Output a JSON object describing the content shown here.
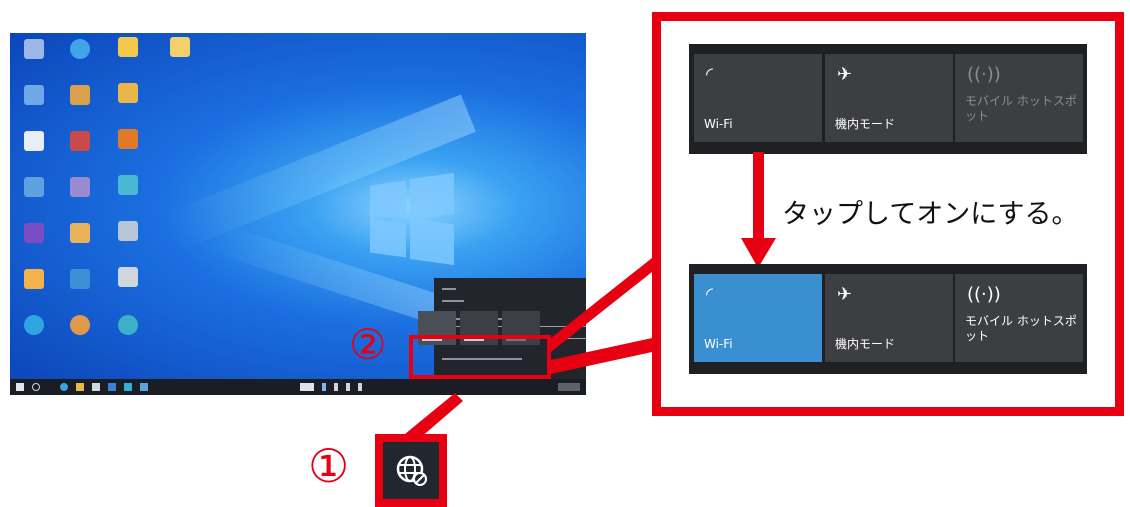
{
  "tiles_before": [
    {
      "label": "Wi-Fi",
      "icon": "wifi-icon",
      "state": "off"
    },
    {
      "label": "機内モード",
      "icon": "airplane-icon",
      "state": "off"
    },
    {
      "label": "モバイル ホットスポット",
      "icon": "hotspot-icon",
      "state": "disabled"
    }
  ],
  "tiles_after": [
    {
      "label": "Wi-Fi",
      "icon": "wifi-icon",
      "state": "on"
    },
    {
      "label": "機内モード",
      "icon": "airplane-icon",
      "state": "off"
    },
    {
      "label": "モバイル ホットスポット",
      "icon": "hotspot-icon",
      "state": "off"
    }
  ],
  "instruction": "タップしてオンにする。",
  "steps": {
    "one": "①",
    "two": "②"
  },
  "colors": {
    "accent_red": "#e60012",
    "tile_on": "#3a8fd0",
    "tile_off": "#3d3e42",
    "panel_bg": "#1f2023"
  }
}
